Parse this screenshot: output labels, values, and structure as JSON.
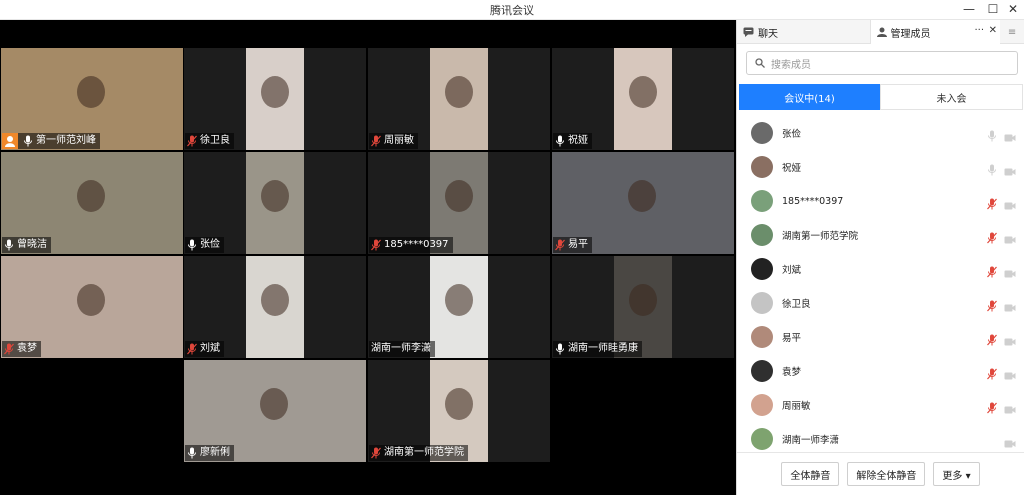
{
  "app": {
    "title": "腾讯会议"
  },
  "window_controls": {
    "minimize": "—",
    "maximize": "☐",
    "close": "✕"
  },
  "tiles": [
    {
      "label": "第一师范刘峰",
      "host": true,
      "mic": "on",
      "bg": "#5e7f9b",
      "photo": "#a58a66"
    },
    {
      "label": "徐卫良",
      "host": false,
      "mic": "muted",
      "bg": "#1d1d1d",
      "photo": "#d8cfc9"
    },
    {
      "label": "周丽敏",
      "host": false,
      "mic": "muted",
      "bg": "#1d1d1d",
      "photo": "#c9b9ab"
    },
    {
      "label": "祝娅",
      "host": false,
      "mic": "on",
      "bg": "#1d1d1d",
      "photo": "#d7c7bd"
    },
    {
      "label": "曾晓洁",
      "host": false,
      "mic": "on",
      "bg": "#4b4a42",
      "photo": "#8d8673"
    },
    {
      "label": "张俭",
      "host": false,
      "mic": "on",
      "bg": "#1d1d1d",
      "photo": "#9a9589"
    },
    {
      "label": "185****0397",
      "host": false,
      "mic": "muted",
      "bg": "#1d1d1d",
      "photo": "#7d7a73"
    },
    {
      "label": "易平",
      "host": false,
      "mic": "muted",
      "bg": "#3f4145",
      "photo": "#5f6065"
    },
    {
      "label": "袁梦",
      "host": false,
      "mic": "muted",
      "bg": "#7a8079",
      "photo": "#b9a69a"
    },
    {
      "label": "刘斌",
      "host": false,
      "mic": "muted",
      "bg": "#1d1d1d",
      "photo": "#d9d6d0"
    },
    {
      "label": "湖南一师李潇",
      "host": false,
      "mic": "none",
      "bg": "#1d1d1d",
      "photo": "#e4e4e2"
    },
    {
      "label": "湖南一师眭勇康",
      "host": false,
      "mic": "on",
      "bg": "#1d1d1d",
      "photo": "#4a4743"
    },
    {
      "label": "",
      "host": false,
      "mic": "none",
      "bg": "#000000",
      "photo": "#000000"
    },
    {
      "label": "廖新俐",
      "host": false,
      "mic": "on",
      "bg": "#8d8b88",
      "photo": "#a09a93"
    },
    {
      "label": "湖南第一师范学院",
      "host": false,
      "mic": "muted",
      "bg": "#1d1d1d",
      "photo": "#d4c9bf"
    }
  ],
  "grid_menu_icon": "list-icon",
  "panel": {
    "tab_chat": "聊天",
    "tab_members": "管理成员",
    "tab_more": "···",
    "tab_close": "✕",
    "tab_menu": "≡",
    "search_placeholder": "搜索成员",
    "seg_in": "会议中(14)",
    "seg_out": "未入会",
    "members": [
      {
        "name": "张俭",
        "mic": "off",
        "avatar": "#6a6a6a"
      },
      {
        "name": "祝娅",
        "mic": "off",
        "avatar": "#8a6f62"
      },
      {
        "name": "185****0397",
        "mic": "muted",
        "avatar": "#7aa07a"
      },
      {
        "name": "湖南第一师范学院",
        "mic": "muted",
        "avatar": "#6b8e6b"
      },
      {
        "name": "刘斌",
        "mic": "muted",
        "avatar": "#222222"
      },
      {
        "name": "徐卫良",
        "mic": "muted",
        "avatar": "#c4c4c4"
      },
      {
        "name": "易平",
        "mic": "muted",
        "avatar": "#b08a7a"
      },
      {
        "name": "袁梦",
        "mic": "muted",
        "avatar": "#2f2f2f"
      },
      {
        "name": "周丽敏",
        "mic": "muted",
        "avatar": "#d2a28f"
      },
      {
        "name": "湖南一师李潇",
        "mic": "none",
        "avatar": "#7ea36f"
      }
    ],
    "btn_mute_all": "全体静音",
    "btn_unmute_all": "解除全体静音",
    "btn_more": "更多 ▾"
  },
  "colors": {
    "accent": "#1e7fff",
    "muted_red": "#e0473b",
    "host_orange": "#f0882a"
  }
}
